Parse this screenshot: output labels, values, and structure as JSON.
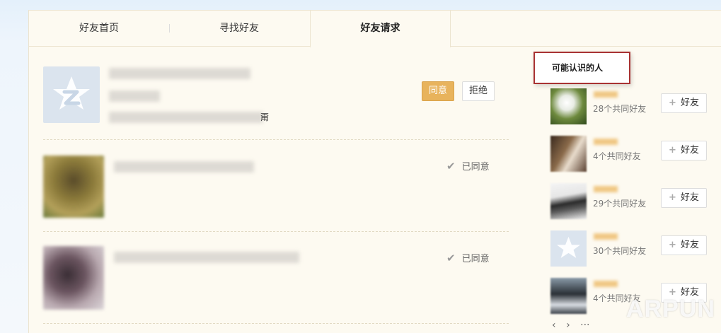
{
  "tabs": [
    {
      "label": "好友首页"
    },
    {
      "label": "寻找好友"
    },
    {
      "label": "好友请求"
    }
  ],
  "requests": [
    {
      "agree_label": "同意",
      "reject_label": "拒绝",
      "trailing_char": "甭",
      "avatar": "qzone-default-avatar"
    },
    {
      "status": "已同意",
      "avatar": "photo-blurred"
    },
    {
      "status": "已同意",
      "avatar": "photo-blurred"
    }
  ],
  "sidebar": {
    "title": "可能认识的人",
    "add_label": "好友",
    "people": [
      {
        "mutual": "28个共同好友"
      },
      {
        "mutual": "4个共同好友"
      },
      {
        "mutual": "29个共同好友"
      },
      {
        "mutual": "30个共同好友"
      },
      {
        "mutual": "4个共同好友"
      }
    ],
    "pager": {
      "prev": "‹",
      "next": "›",
      "more": "···"
    }
  },
  "watermark": "ARPUN",
  "colors": {
    "accent": "#e8b35c",
    "highlight_border": "#a83232",
    "panel_bg": "#fdfaf1"
  }
}
